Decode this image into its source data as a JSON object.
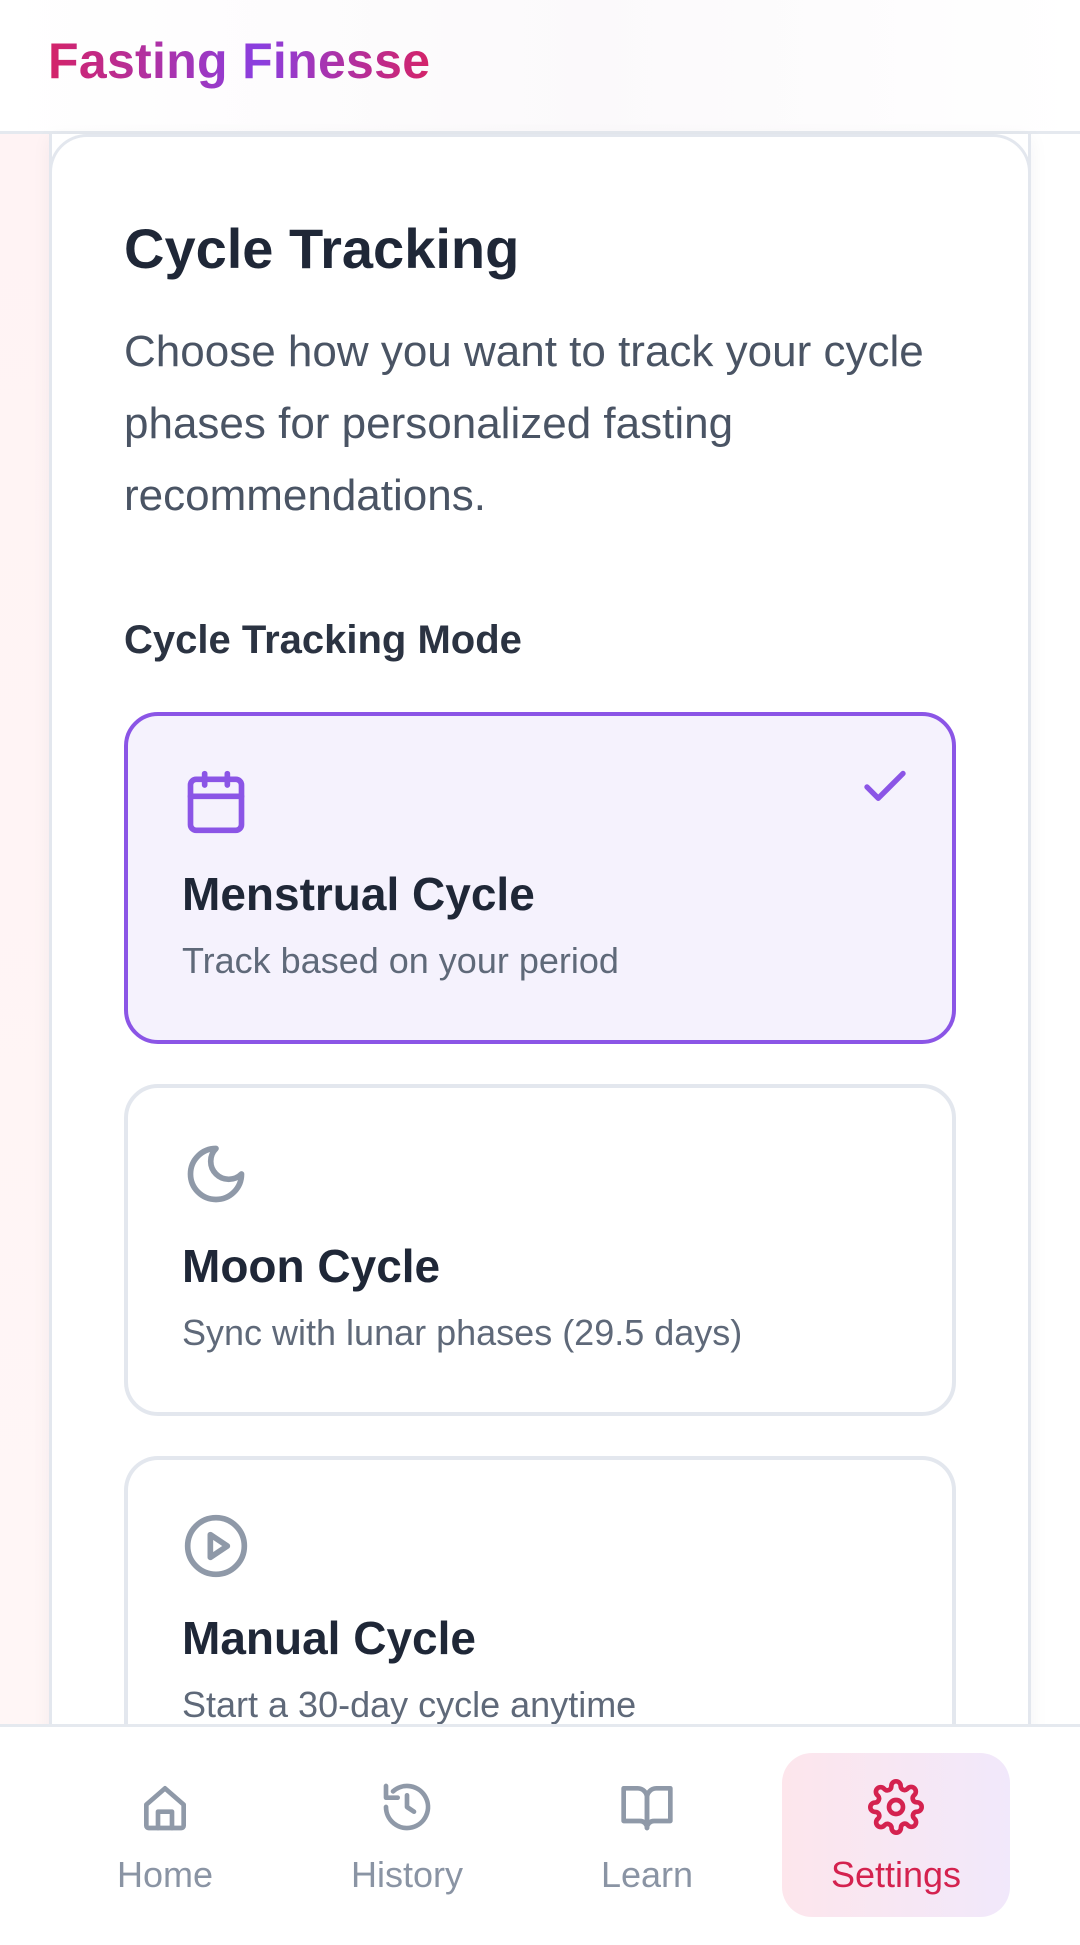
{
  "app": {
    "brand": "Fasting Finesse"
  },
  "colors": {
    "accent_purple": "#8b55e6",
    "accent_pink": "#d42368",
    "selected_bg": "#f5f2fd",
    "muted_icon": "#8f99a8"
  },
  "settings": {
    "title": "Cycle Tracking",
    "description": "Choose how you want to track your cycle phases for personalized fasting recommendations.",
    "mode_label": "Cycle Tracking Mode",
    "options": [
      {
        "icon": "calendar-icon",
        "title": "Menstrual Cycle",
        "subtitle": "Track based on your period",
        "selected": true
      },
      {
        "icon": "moon-icon",
        "title": "Moon Cycle",
        "subtitle": "Sync with lunar phases (29.5 days)",
        "selected": false
      },
      {
        "icon": "play-circle-icon",
        "title": "Manual Cycle",
        "subtitle": "Start a 30-day cycle anytime",
        "selected": false
      }
    ]
  },
  "nav": {
    "items": [
      {
        "icon": "home-icon",
        "label": "Home",
        "active": false
      },
      {
        "icon": "history-icon",
        "label": "History",
        "active": false
      },
      {
        "icon": "book-open-icon",
        "label": "Learn",
        "active": false
      },
      {
        "icon": "gear-icon",
        "label": "Settings",
        "active": true
      }
    ]
  }
}
